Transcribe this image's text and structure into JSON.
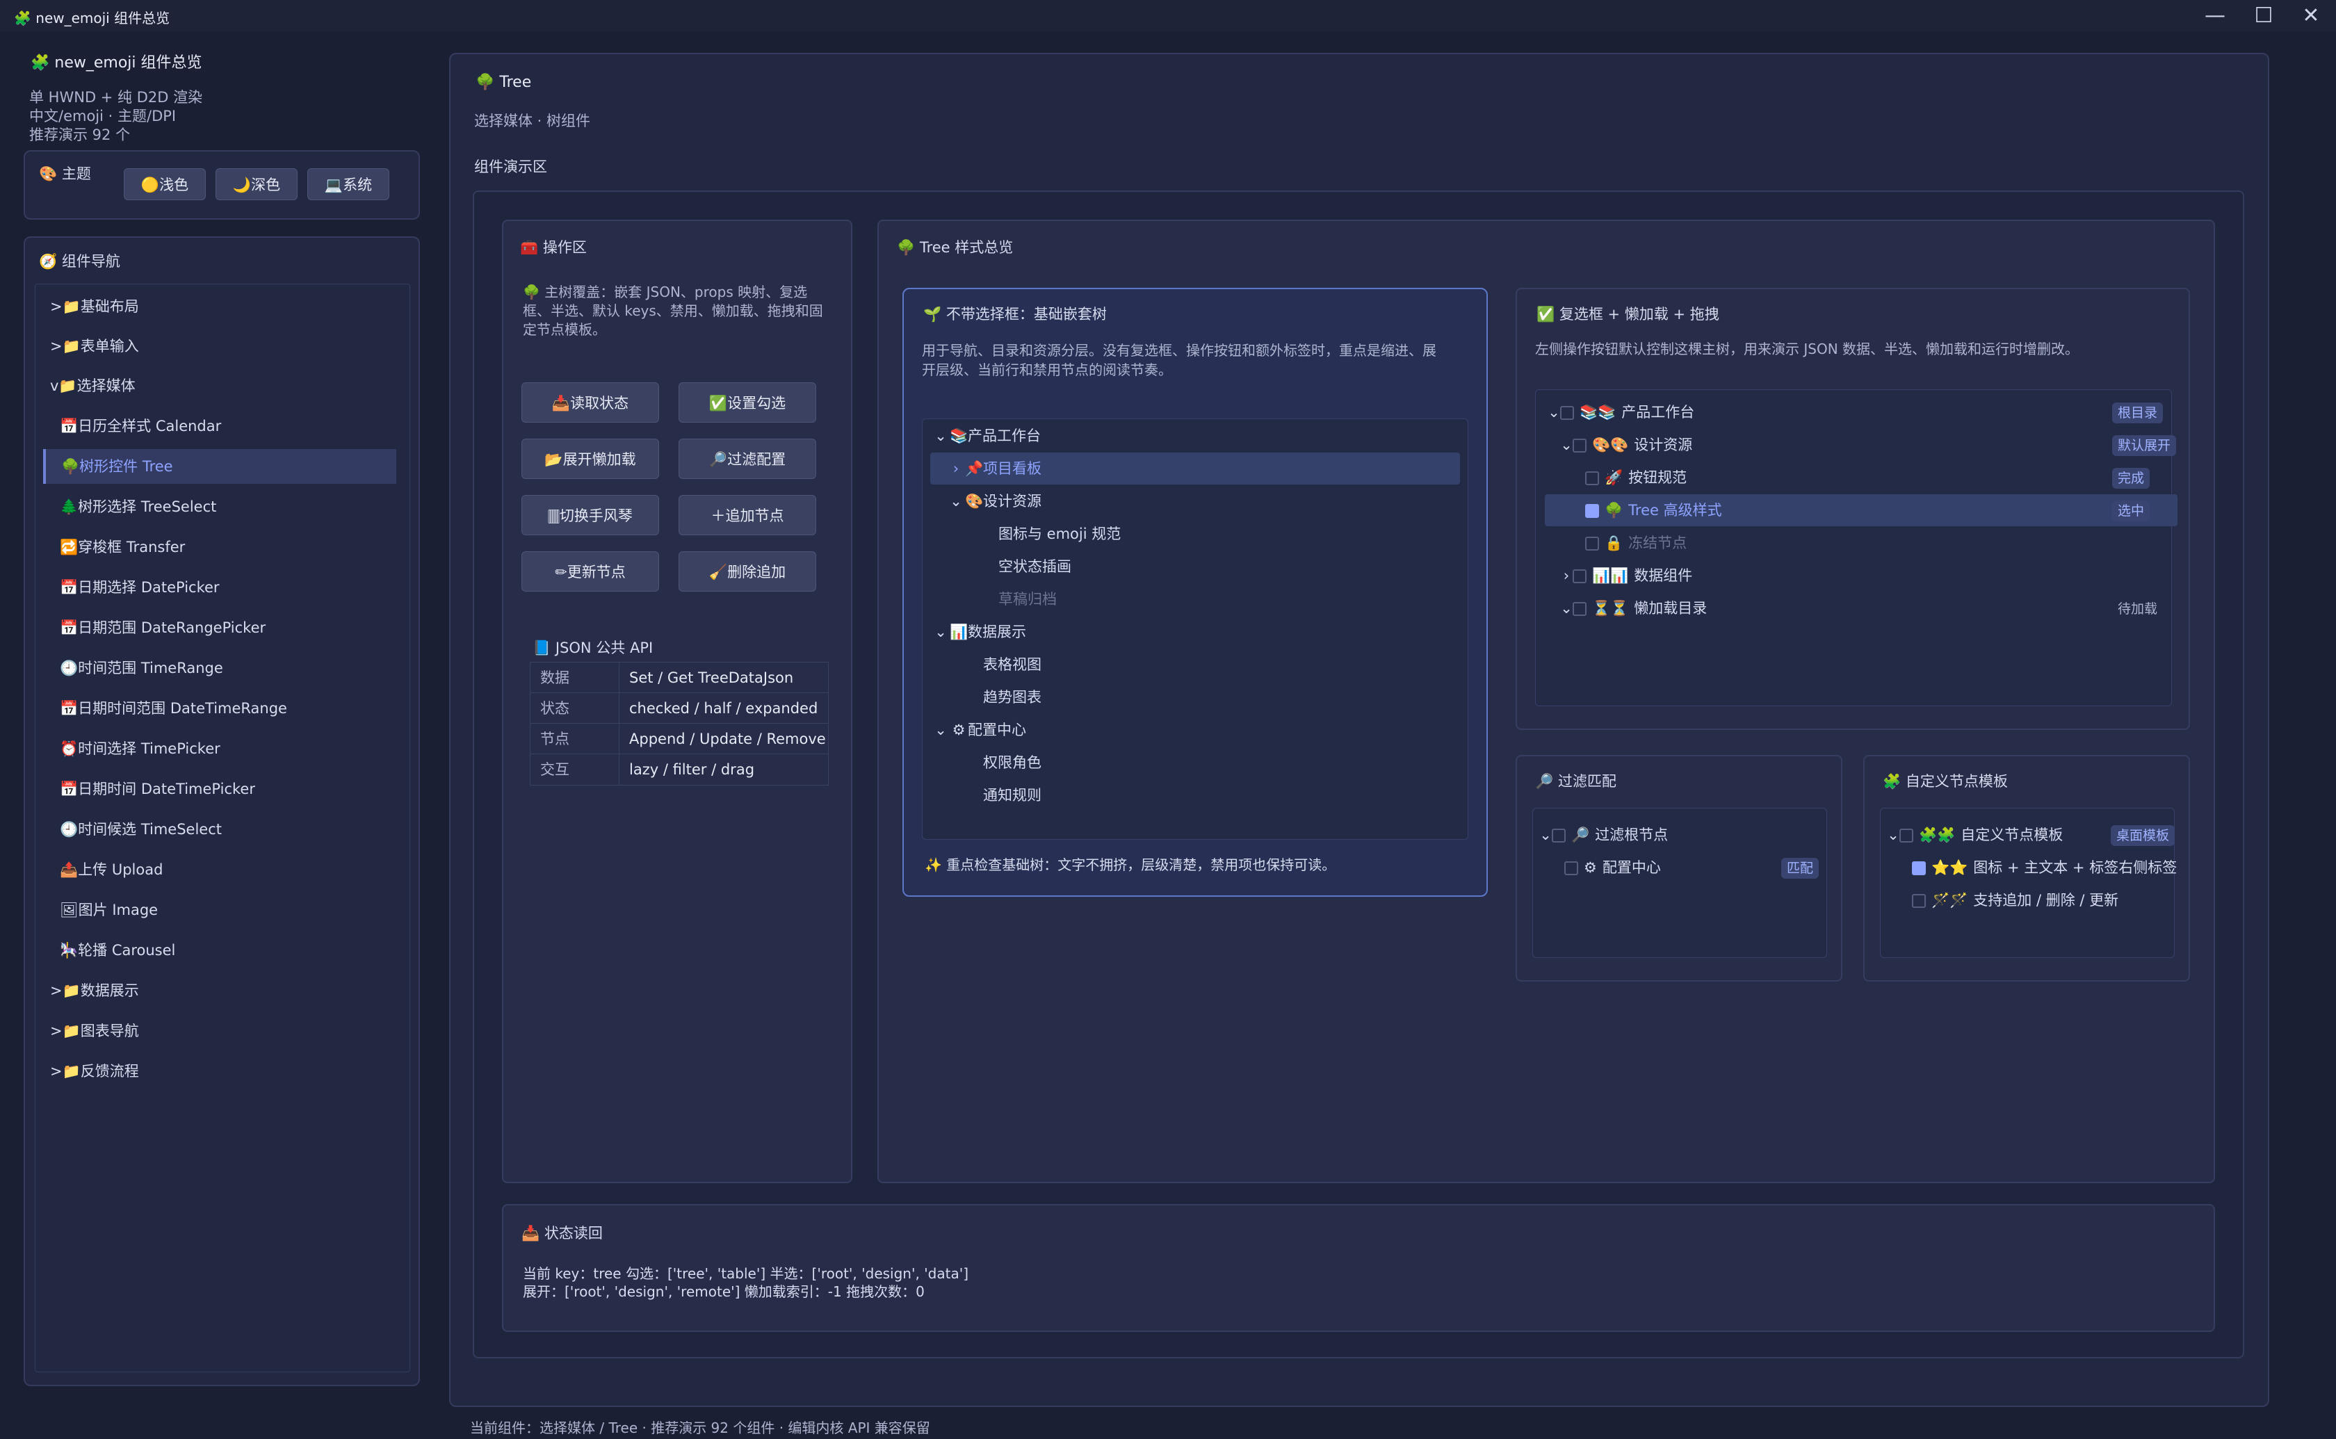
{
  "window": {
    "title": "new_emoji 组件总览",
    "app_icon": "puzzle-icon",
    "controls": {
      "minimize": "—",
      "maximize": "☐",
      "close": "✕"
    }
  },
  "sidebar": {
    "app_title": "new_emoji 组件总览",
    "info": [
      "单 HWND + 纯 D2D 渲染",
      "中文/emoji · 主题/DPI",
      "推荐演示 92 个"
    ],
    "theme": {
      "label": "主题",
      "options": [
        {
          "icon": "🟡",
          "label": "浅色"
        },
        {
          "icon": "🌙",
          "label": "深色"
        },
        {
          "icon": "💻",
          "label": "系统"
        }
      ]
    },
    "nav_title": "组件导航",
    "nav_items": [
      {
        "label": ">📁基础布局"
      },
      {
        "label": ">📁表单输入"
      },
      {
        "label": "v📁选择媒体"
      },
      {
        "label": "📅日历全样式 Calendar"
      },
      {
        "label": "🌳树形控件 Tree",
        "selected": true
      },
      {
        "label": "🌲树形选择 TreeSelect"
      },
      {
        "label": "🔁穿梭框 Transfer"
      },
      {
        "label": "📅日期选择 DatePicker"
      },
      {
        "label": "📅日期范围 DateRangePicker"
      },
      {
        "label": "🕘时间范围 TimeRange"
      },
      {
        "label": "📅日期时间范围 DateTimeRange"
      },
      {
        "label": "⏰时间选择 TimePicker"
      },
      {
        "label": "📅日期时间 DateTimePicker"
      },
      {
        "label": "🕘时间候选 TimeSelect"
      },
      {
        "label": "📤上传 Upload"
      },
      {
        "label": "🖼图片 Image"
      },
      {
        "label": "🎠轮播 Carousel"
      },
      {
        "label": ">📁数据展示"
      },
      {
        "label": ">📁图表导航"
      },
      {
        "label": ">📁反馈流程"
      }
    ]
  },
  "header": {
    "title": "Tree",
    "subtitle": "选择媒体 · 树组件",
    "demo_area": "组件演示区"
  },
  "ops": {
    "title": "操作区",
    "desc": [
      "🌳 主树覆盖：嵌套 JSON、props 映射、复选",
      "框、半选、默认 keys、禁用、懒加载、拖拽和固",
      "定节点模板。"
    ],
    "buttons": [
      {
        "label": "📥读取状态"
      },
      {
        "label": "✅设置勾选"
      },
      {
        "label": "📂展开懒加载"
      },
      {
        "label": "🔎过滤配置"
      },
      {
        "label": "🀫切换手风琴"
      },
      {
        "label": "＋追加节点"
      },
      {
        "label": "✏更新节点"
      },
      {
        "label": "🧹删除追加"
      }
    ],
    "api_title": "JSON 公共 API",
    "api_rows": [
      {
        "k": "数据",
        "v": "Set / Get TreeDataJson"
      },
      {
        "k": "状态",
        "v": "checked / half / expanded"
      },
      {
        "k": "节点",
        "v": "Append / Update / Remove"
      },
      {
        "k": "交互",
        "v": "lazy / filter / drag"
      }
    ]
  },
  "overview": {
    "title": "Tree 样式总览",
    "basic": {
      "title": "不带选择框：基础嵌套树",
      "desc": [
        "用于导航、目录和资源分层。没有复选框、操作按钮和额外标签时，重点是缩进、展",
        "开层级、当前行和禁用节点的阅读节奏。"
      ],
      "nodes": [
        {
          "arrow": "⌄",
          "icon": "📚",
          "label": "产品工作台"
        },
        {
          "arrow": "›",
          "icon": "📌",
          "label": "项目看板"
        },
        {
          "arrow": "⌄",
          "icon": "🎨",
          "label": "设计资源"
        },
        {
          "arrow": "",
          "icon": "",
          "label": "图标与 emoji 规范"
        },
        {
          "arrow": "",
          "icon": "",
          "label": "空状态插画"
        },
        {
          "arrow": "",
          "icon": "",
          "label": "草稿归档"
        },
        {
          "arrow": "⌄",
          "icon": "📊",
          "label": "数据展示"
        },
        {
          "arrow": "",
          "icon": "",
          "label": "表格视图"
        },
        {
          "arrow": "",
          "icon": "",
          "label": "趋势图表"
        },
        {
          "arrow": "⌄",
          "icon": "⚙",
          "label": "配置中心"
        },
        {
          "arrow": "",
          "icon": "",
          "label": "权限角色"
        },
        {
          "arrow": "",
          "icon": "",
          "label": "通知规则"
        }
      ],
      "footer": "✨ 重点检查基础树：文字不拥挤，层级清楚，禁用项也保持可读。"
    },
    "checkbox": {
      "title": "复选框 + 懒加载 + 拖拽",
      "desc": "左侧操作按钮默认控制这棵主树，用来演示 JSON 数据、半选、懒加载和运行时增删改。",
      "nodes": [
        {
          "label": "产品工作台",
          "icon": "📚📚",
          "tag": "根目录"
        },
        {
          "label": "设计资源",
          "icon": "🎨🎨",
          "tag": "默认展开"
        },
        {
          "label": "按钮规范",
          "icon": "🚀",
          "tag": "完成"
        },
        {
          "label": "Tree 高级样式",
          "icon": "🌳",
          "tag": "选中"
        },
        {
          "label": "冻结节点",
          "icon": "🔒",
          "tag": ""
        },
        {
          "label": "数据组件",
          "icon": "📊📊",
          "tag": ""
        },
        {
          "label": "懒加载目录",
          "icon": "⏳⏳",
          "tag": "待加载"
        }
      ]
    },
    "filter": {
      "title": "过滤匹配",
      "nodes": [
        {
          "label": "过滤根节点",
          "icon": "🔎",
          "tag": ""
        },
        {
          "label": "配置中心",
          "icon": "⚙",
          "tag": "匹配"
        }
      ]
    },
    "template": {
      "title": "自定义节点模板",
      "nodes": [
        {
          "label": "自定义节点模板",
          "icon": "🧩🧩",
          "tag": "桌面模板"
        },
        {
          "label": "图标 + 主文本 + 标签右侧标签",
          "icon": "⭐⭐",
          "tag": ""
        },
        {
          "label": "支持追加 / 删除 / 更新",
          "icon": "🪄🪄",
          "tag": ""
        }
      ]
    }
  },
  "status": {
    "title": "状态读回",
    "line1": "当前 key：tree  勾选：['tree', 'table']  半选：['root', 'design', 'data']",
    "line2": "展开：['root', 'design', 'remote']  懒加载索引：-1  拖拽次数：0"
  },
  "footer_text": "当前组件：选择媒体 / Tree · 推荐演示 92 个组件 · 编辑内核 API 兼容保留",
  "colors": {
    "background": "#1b1f34",
    "panel": "#232842",
    "accent": "#8ea3ff",
    "selected_row": "#3b4670"
  }
}
